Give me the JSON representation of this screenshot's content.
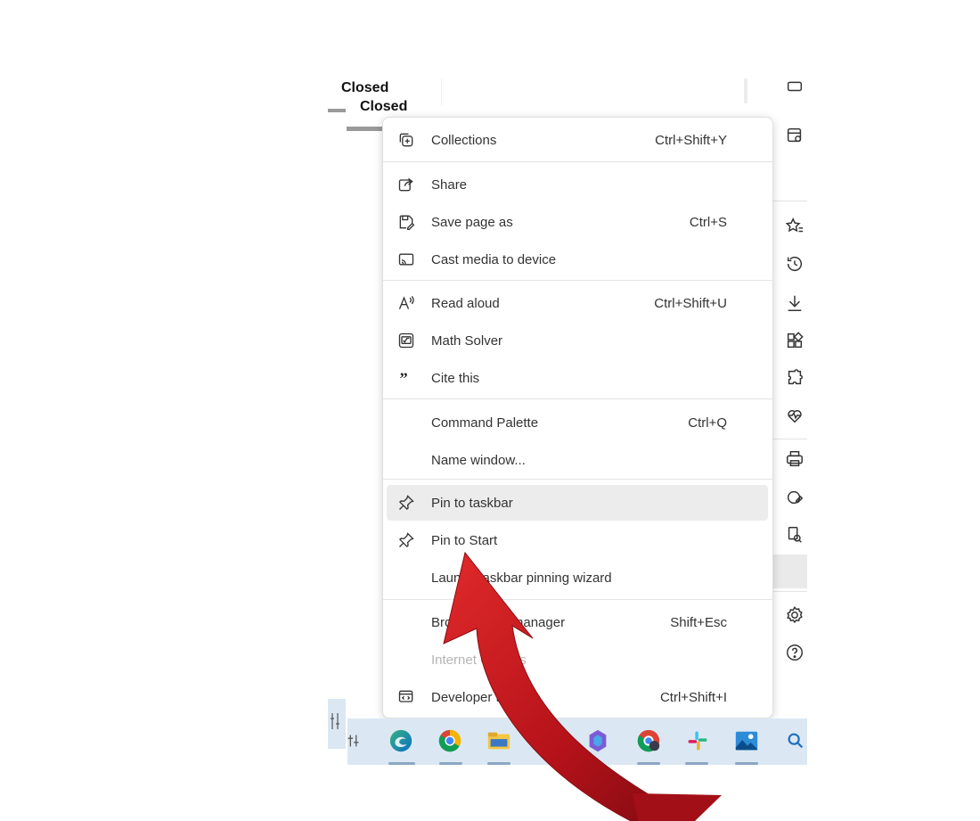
{
  "background": {
    "tab_title_1": "Closed",
    "tab_title_2": "Closed"
  },
  "menu": {
    "items": [
      {
        "label": "Collections",
        "shortcut": "Ctrl+Shift+Y",
        "icon": "collections-icon"
      },
      {
        "label": "Share",
        "shortcut": "",
        "icon": "share-icon"
      },
      {
        "label": "Save page as",
        "shortcut": "Ctrl+S",
        "icon": "save-page-icon"
      },
      {
        "label": "Cast media to device",
        "shortcut": "",
        "icon": "cast-icon"
      },
      {
        "label": "Read aloud",
        "shortcut": "Ctrl+Shift+U",
        "icon": "read-aloud-icon"
      },
      {
        "label": "Math Solver",
        "shortcut": "",
        "icon": "math-solver-icon"
      },
      {
        "label": "Cite this",
        "shortcut": "",
        "icon": "quote-icon"
      },
      {
        "label": "Command Palette",
        "shortcut": "Ctrl+Q",
        "icon": ""
      },
      {
        "label": "Name window...",
        "shortcut": "",
        "icon": ""
      },
      {
        "label": "Pin to taskbar",
        "shortcut": "",
        "icon": "pin-icon",
        "highlighted": true
      },
      {
        "label": "Pin to Start",
        "shortcut": "",
        "icon": "pin-icon"
      },
      {
        "label": "Launch taskbar pinning wizard",
        "shortcut": "",
        "icon": ""
      },
      {
        "label": "Browser task manager",
        "shortcut": "Shift+Esc",
        "icon": ""
      },
      {
        "label": "Internet Options",
        "shortcut": "",
        "icon": "",
        "disabled": true
      },
      {
        "label": "Developer tools",
        "shortcut": "Ctrl+Shift+I",
        "icon": "developer-tools-icon"
      }
    ]
  },
  "sidebar": {
    "icons": [
      "favorites-icon",
      "history-icon",
      "download-icon",
      "apps-icon",
      "extensions-icon",
      "health-icon",
      "print-icon",
      "screenshot-icon",
      "find-icon",
      "settings-icon",
      "help-icon"
    ]
  },
  "taskbar": {
    "apps": [
      "edge-icon",
      "chrome-icon",
      "file-explorer-icon",
      "app-icon",
      "copilot-icon",
      "chrome-profile-icon",
      "slack-icon",
      "photos-icon",
      "search-icon"
    ]
  },
  "colors": {
    "arrow": "#c0141b",
    "taskbar": "#dbe8f3",
    "highlight": "#ececec"
  }
}
